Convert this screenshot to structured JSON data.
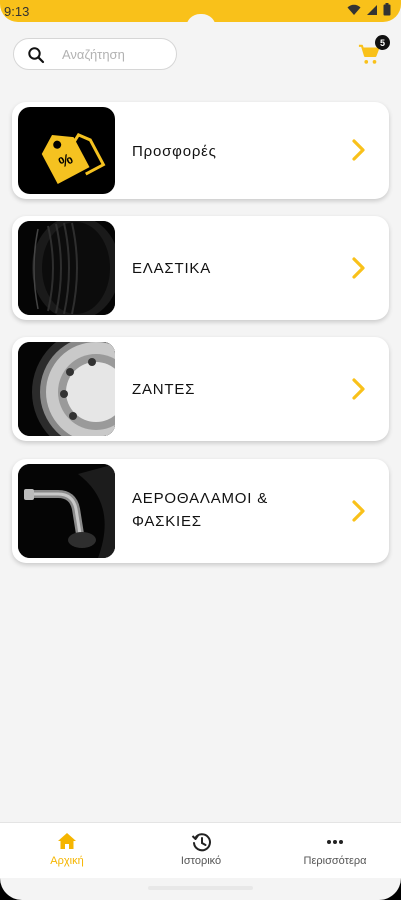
{
  "status_bar": {
    "time": "9:13",
    "icons": [
      "wifi-icon",
      "signal-icon",
      "battery-icon"
    ]
  },
  "search": {
    "placeholder": "Αναζήτηση",
    "icon": "search-icon"
  },
  "cart": {
    "icon": "cart-icon",
    "badge_count": "5"
  },
  "categories": [
    {
      "label": "Προσφορές",
      "image": "offers-tag-icon"
    },
    {
      "label": "ΕΛΑΣΤΙΚΑ",
      "image": "tire-image"
    },
    {
      "label": "ΖΑΝΤΕΣ",
      "image": "wheel-rim-image"
    },
    {
      "label_line1": "ΑΕΡΟΘΑΛΑΜΟΙ &",
      "label_line2": "ΦΑΣΚΙΕΣ",
      "image": "inner-tube-valve-image"
    }
  ],
  "bottom_nav": [
    {
      "label": "Αρχική",
      "icon": "home-icon",
      "active": true
    },
    {
      "label": "Ιστορικό",
      "icon": "history-icon",
      "active": false
    },
    {
      "label": "Περισσότερα",
      "icon": "more-icon",
      "active": false
    }
  ],
  "colors": {
    "accent": "#f9c11a",
    "active_nav": "#f5b500",
    "background": "#f4f4f4"
  }
}
